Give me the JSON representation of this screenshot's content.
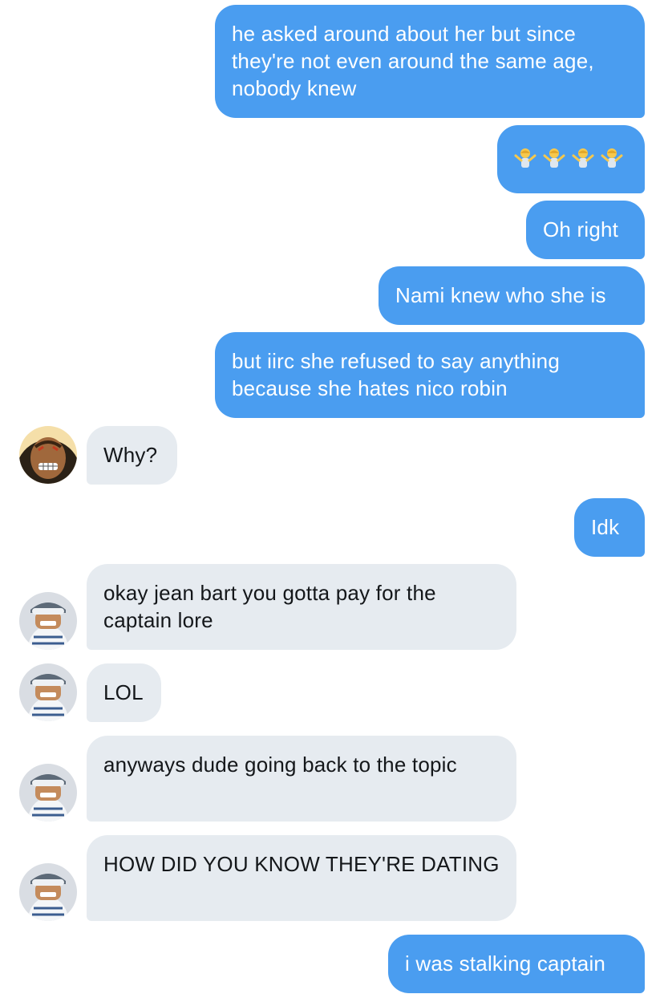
{
  "messages": [
    {
      "side": "out",
      "text": "he asked around about her but since they're not even around the same age, nobody knew"
    },
    {
      "side": "out",
      "text": "🤷🤷🤷🤷",
      "emoji": "person-shrugging-emoji",
      "count": 4
    },
    {
      "side": "out",
      "text": "Oh right"
    },
    {
      "side": "out",
      "text": "Nami knew who she is"
    },
    {
      "side": "out",
      "text": "but iirc she refused to say anything because she hates nico robin"
    },
    {
      "side": "in",
      "avatar": "jean-bart-avatar",
      "text": "Why?"
    },
    {
      "side": "out",
      "text": "Idk"
    },
    {
      "side": "in",
      "avatar": "penguin-avatar",
      "text": "okay jean bart you gotta pay for the captain lore"
    },
    {
      "side": "in",
      "avatar": "penguin-avatar",
      "text": "LOL"
    },
    {
      "side": "in",
      "avatar": "penguin-avatar",
      "text": "anyways dude going back to the topic"
    },
    {
      "side": "in",
      "avatar": "penguin-avatar",
      "text": "HOW DID YOU KNOW THEY'RE DATING"
    },
    {
      "side": "out",
      "text": "i was stalking captain"
    }
  ],
  "colors": {
    "outgoing_bubble": "#4a9df0",
    "incoming_bubble": "#e6ebf0",
    "outgoing_text": "#ffffff",
    "incoming_text": "#14171a"
  }
}
